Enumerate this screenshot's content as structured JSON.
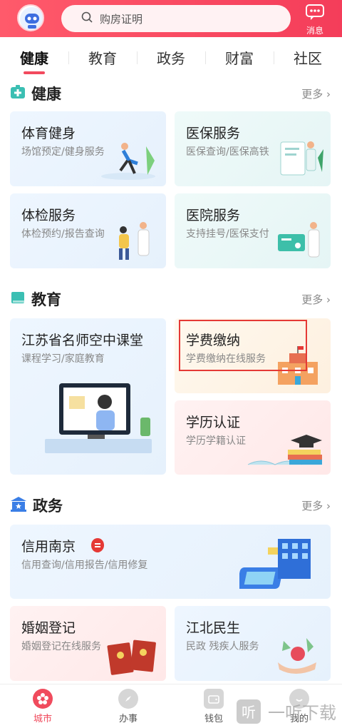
{
  "header": {
    "search_placeholder": "购房证明",
    "message_label": "消息"
  },
  "tabs": [
    {
      "label": "健康",
      "active": true
    },
    {
      "label": "教育",
      "active": false
    },
    {
      "label": "政务",
      "active": false
    },
    {
      "label": "财富",
      "active": false
    },
    {
      "label": "社区",
      "active": false
    }
  ],
  "sections": {
    "health": {
      "title": "健康",
      "more": "更多",
      "cards": [
        {
          "title": "体育健身",
          "subtitle": "场馆预定/健身服务"
        },
        {
          "title": "医保服务",
          "subtitle": "医保查询/医保高铁"
        },
        {
          "title": "体检服务",
          "subtitle": "体检预约/报告查询"
        },
        {
          "title": "医院服务",
          "subtitle": "支持挂号/医保支付"
        }
      ]
    },
    "education": {
      "title": "教育",
      "more": "更多",
      "cards": [
        {
          "title": "江苏省名师空中课堂",
          "subtitle": "课程学习/家庭教育"
        },
        {
          "title": "学费缴纳",
          "subtitle": "学费缴纳在线服务"
        },
        {
          "title": "学历认证",
          "subtitle": "学历学籍认证"
        }
      ]
    },
    "government": {
      "title": "政务",
      "more": "更多",
      "cards": [
        {
          "title": "信用南京",
          "subtitle": "信用查询/信用报告/信用修复"
        },
        {
          "title": "婚姻登记",
          "subtitle": "婚姻登记在线服务"
        },
        {
          "title": "江北民生",
          "subtitle": "民政 残疾人服务"
        }
      ]
    }
  },
  "bottom_nav": [
    {
      "label": "城市",
      "active": true
    },
    {
      "label": "办事",
      "active": false
    },
    {
      "label": "钱包",
      "active": false
    },
    {
      "label": "我的",
      "active": false
    }
  ],
  "watermark": "一听下载",
  "colors": {
    "brand": "#f24a5e",
    "highlight": "#e53935"
  }
}
